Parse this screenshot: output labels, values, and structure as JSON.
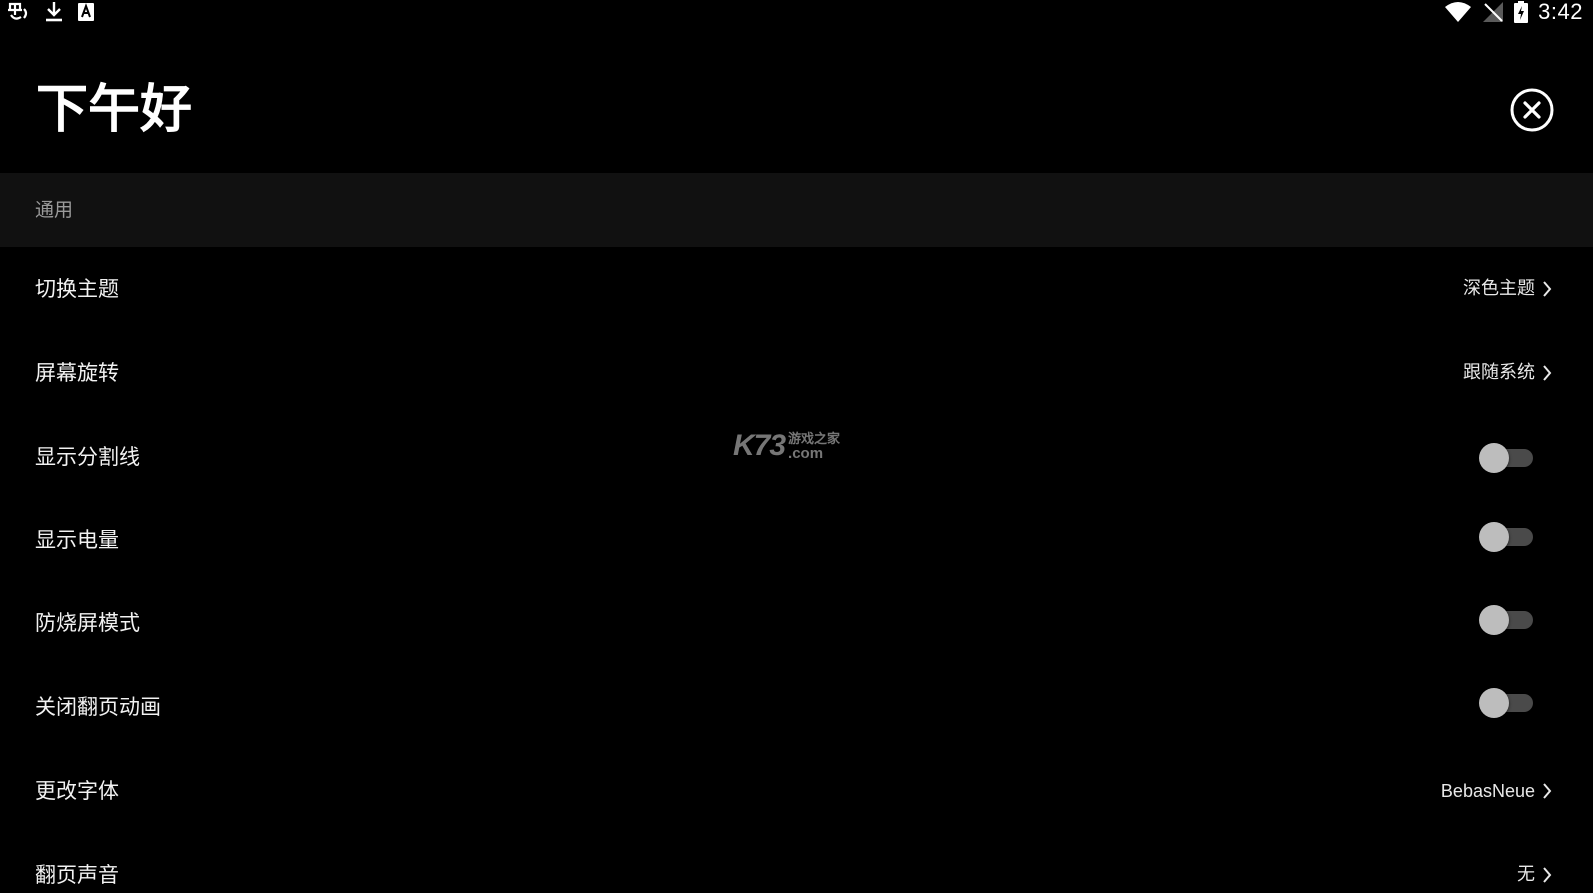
{
  "status_bar": {
    "left_icons": [
      "sync-app-icon",
      "download-icon",
      "keyboard-a-icon"
    ],
    "right_icons": [
      "wifi-icon",
      "no-sim-icon",
      "battery-charging-icon"
    ],
    "time": "3:42"
  },
  "header": {
    "greeting": "下午好",
    "close_icon": "close-circle-icon"
  },
  "section": {
    "title": "通用"
  },
  "settings": [
    {
      "label": "切换主题",
      "type": "select",
      "value": "深色主题"
    },
    {
      "label": "屏幕旋转",
      "type": "select",
      "value": "跟随系统"
    },
    {
      "label": "显示分割线",
      "type": "toggle",
      "on": false
    },
    {
      "label": "显示电量",
      "type": "toggle",
      "on": false
    },
    {
      "label": "防烧屏模式",
      "type": "toggle",
      "on": false
    },
    {
      "label": "关闭翻页动画",
      "type": "toggle",
      "on": false
    },
    {
      "label": "更改字体",
      "type": "select",
      "value": "BebasNeue"
    },
    {
      "label": "翻页声音",
      "type": "select",
      "value": "无"
    }
  ],
  "watermark": {
    "brand": "K73",
    "cn": "游戏之家",
    "domain": ".com"
  },
  "colors": {
    "background": "#000000",
    "section_bg": "#111111",
    "section_text": "#9a9a9a",
    "text": "#f2f2f2",
    "toggle_track_off": "#4a4a4a",
    "toggle_thumb_off": "#bdbdbd"
  }
}
